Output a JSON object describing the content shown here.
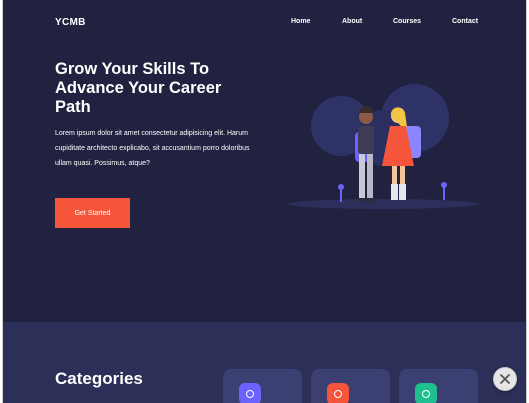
{
  "brand": {
    "logo": "YCMB"
  },
  "nav": {
    "items": [
      {
        "label": "Home"
      },
      {
        "label": "About"
      },
      {
        "label": "Courses"
      },
      {
        "label": "Contact"
      }
    ]
  },
  "hero": {
    "title": "Grow Your Skills To Advance Your Career Path",
    "body": "Lorem ipsum dolor sit amet consectetur adipisicing elit. Harum cupiditate architecto explicabo, sit accusantium porro doloribus ullam quasi. Possimus, atque?",
    "cta_label": "Get Started",
    "illustration_icon": "students-illustration"
  },
  "categories": {
    "title": "Categories",
    "cards": [
      {
        "icon": "category-icon",
        "color": "#6c63ff"
      },
      {
        "icon": "category-icon",
        "color": "#f5563b"
      },
      {
        "icon": "category-icon",
        "color": "#1fbf8f"
      }
    ]
  },
  "overlay": {
    "close_icon": "close-icon"
  },
  "colors": {
    "hero_bg": "#20223f",
    "section_bg": "#2c2f58",
    "card_bg": "#3c3f71",
    "accent": "#f5563b"
  }
}
